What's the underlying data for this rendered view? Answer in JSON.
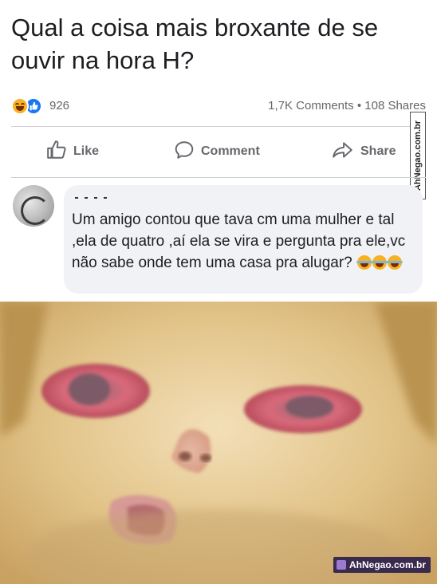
{
  "post": {
    "title": "Qual a coisa mais broxante de se ouvir na hora H?",
    "reaction_count": "926",
    "comments_shares": "1,7K Comments • 108 Shares",
    "reactions": [
      "haha-icon",
      "like-icon"
    ]
  },
  "actions": {
    "like_label": "Like",
    "comment_label": "Comment",
    "share_label": "Share"
  },
  "comment": {
    "text": "Um amigo contou que tava cm uma mulher e tal ,ela de quatro ,aí ela se vira e pergunta pra ele,vc não sabe onde tem uma casa pra alugar?",
    "emojis": [
      "laughing-crying-emoji",
      "laughing-crying-emoji",
      "laughing-crying-emoji"
    ]
  },
  "watermarks": {
    "side": "AhNegao.com.br",
    "photo": "AhNegao.com.br"
  },
  "colors": {
    "meta_text": "#65676b",
    "comment_bg": "#f0f2f5",
    "like_blue": "#1877f2",
    "haha_yellow": "#f7b125"
  }
}
